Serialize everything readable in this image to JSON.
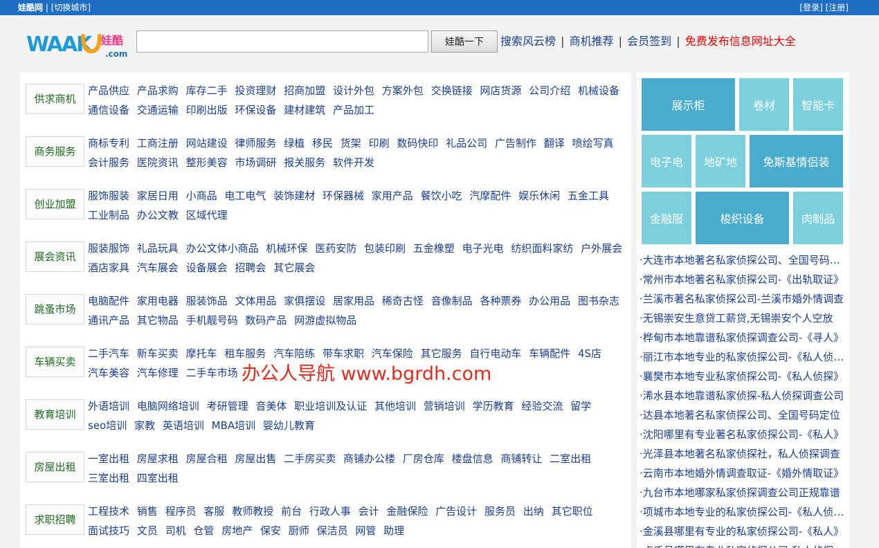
{
  "topbar": {
    "site_name": "娃酷网",
    "separator": "|",
    "switch_city": "[切换城市]",
    "login": "[登录]",
    "register": "[注册]"
  },
  "logo": {
    "text_main": "WAAKU",
    "text_cn": "娃酷",
    "text_com": ".com"
  },
  "search": {
    "value": "",
    "placeholder": "",
    "button_label": "娃酷一下"
  },
  "header_links": [
    {
      "label": "搜索风云榜",
      "color": "#1a3e8c"
    },
    {
      "label": "商机推荐",
      "color": "#1a3e8c"
    },
    {
      "label": "会员签到",
      "color": "#1a3e8c"
    },
    {
      "label": "免费发布信息网址大全",
      "color": "#e10000"
    }
  ],
  "categories": [
    {
      "name": "供求商机",
      "links": [
        "产品供应",
        "产品求购",
        "库存二手",
        "投资理财",
        "招商加盟",
        "设计外包",
        "方案外包",
        "交换链接",
        "网店货源",
        "公司介绍",
        "机械设备",
        "通信设备",
        "交通运输",
        "印刷出版",
        "环保设备",
        "建材建筑",
        "产品加工"
      ]
    },
    {
      "name": "商务服务",
      "links": [
        "商标专利",
        "工商注册",
        "网站建设",
        "律师服务",
        "绿植",
        "移民",
        "货架",
        "印刷",
        "数码快印",
        "礼品公司",
        "广告制作",
        "翻译",
        "喷绘写真",
        "会计服务",
        "医院资讯",
        "整形美容",
        "市场调研",
        "报关服务",
        "软件开发"
      ]
    },
    {
      "name": "创业加盟",
      "links": [
        "服饰服装",
        "家居日用",
        "小商品",
        "电工电气",
        "装饰建材",
        "环保器械",
        "家用产品",
        "餐饮小吃",
        "汽摩配件",
        "娱乐休闲",
        "五金工具",
        "工业制品",
        "办公文教",
        "区域代理"
      ]
    },
    {
      "name": "展会资讯",
      "links": [
        "服装服饰",
        "礼品玩具",
        "办公文体小商品",
        "机械环保",
        "医药安防",
        "包装印刷",
        "五金橡塑",
        "电子光电",
        "纺织面料家纺",
        "户外展会",
        "酒店家具",
        "汽车展会",
        "设备展会",
        "招聘会",
        "其它展会"
      ]
    },
    {
      "name": "跳蚤市场",
      "links": [
        "电脑配件",
        "家用电器",
        "服装饰品",
        "文体用品",
        "家俱摆设",
        "居家用品",
        "稀奇古怪",
        "音像制品",
        "各种票券",
        "办公用品",
        "图书杂志",
        "通讯产品",
        "其它物品",
        "手机靓号码",
        "数码产品",
        "网游虚拟物品"
      ]
    },
    {
      "name": "车辆买卖",
      "links": [
        "二手汽车",
        "新车买卖",
        "摩托车",
        "租车服务",
        "汽车陪练",
        "带车求职",
        "汽车保险",
        "其它服务",
        "自行电动车",
        "车辆配件",
        "4S店",
        "汽车美容",
        "汽车修理",
        "二手车市场"
      ]
    },
    {
      "name": "教育培训",
      "links": [
        "外语培训",
        "电脑网络培训",
        "考研管理",
        "音美体",
        "职业培训及认证",
        "其他培训",
        "营销培训",
        "学历教育",
        "经验交流",
        "留学",
        "seo培训",
        "家教",
        "英语培训",
        "MBA培训",
        "婴幼儿教育"
      ]
    },
    {
      "name": "房屋出租",
      "links": [
        "一室出租",
        "房屋求租",
        "房屋合租",
        "房屋出售",
        "二手房买卖",
        "商铺办公楼",
        "厂房仓库",
        "楼盘信息",
        "商铺转让",
        "二室出租",
        "三室出租",
        "四室出租"
      ]
    },
    {
      "name": "求职招聘",
      "links": [
        "工程技术",
        "销售",
        "程序员",
        "客服",
        "教师教授",
        "前台",
        "行政人事",
        "会计",
        "金融保险",
        "广告设计",
        "服务员",
        "出纳",
        "其它职位",
        "面试技巧",
        "文员",
        "司机",
        "仓管",
        "房地产",
        "保安",
        "厨师",
        "保洁员",
        "网管",
        "助理"
      ]
    }
  ],
  "watermark": "办公人导航 www.bgrdh.com",
  "tiles": [
    "展示柜",
    "卷材",
    "智能卡",
    "电子电",
    "地矿地",
    "免斯基情侣装",
    "金融服",
    "梭织设备",
    "肉制品"
  ],
  "colors": {
    "tile_dark": "#4aaccd",
    "tile_light": "#7ccfdc",
    "topbar": "#1e6fc3"
  },
  "side_news": [
    "·大连市本地著名私家侦探公司、全国号码定位",
    "·常州市本地著名私家侦探公司-《出轨取证》",
    "·兰溪市著名私家侦探公司-兰溪市婚外情调查",
    "·无锡崇安生意贷工薪贷,无锡崇安个人空放",
    "·桦甸市本地靠谱私家侦探调查公司-《寻人》",
    "·丽江市本地专业的私家侦探公司-《私人侦探》",
    "·襄樊市本地专业私家侦探公司-《私人侦探》",
    "·浠水县本地靠谱私家侦探-私人侦探调查公司",
    "·达县本地著名私家侦探公司、全国号码定位",
    "·沈阳哪里有专业著名私家侦探公司-《私人》",
    "·光泽县本地著名私家侦探社，私人侦探调查",
    "·云南市本地婚外情调查取证-《婚外情取证》",
    "·九台市本地哪家私家侦探调查公司正规靠谱",
    "·项城市本地专业的私家侦探公司-《私人侦探》",
    "·金溪县哪里有专业的私家侦探公司-《私人》",
    "·卢氏县哪里有专业私家侦探公司-私人侦探"
  ]
}
